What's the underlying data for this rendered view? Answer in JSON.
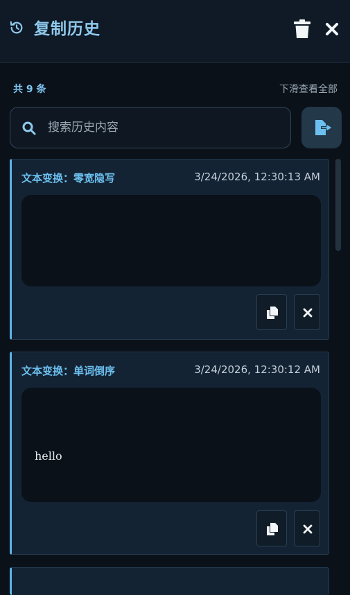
{
  "header": {
    "title": "复制历史",
    "icons": {
      "history": "history-icon",
      "trash": "trash-icon",
      "close": "close-icon"
    }
  },
  "summary": {
    "count_label": "共 9 条",
    "scroll_hint": "下滑查看全部"
  },
  "search": {
    "placeholder": "搜索历史内容",
    "value": ""
  },
  "export": {
    "icon": "export-icon"
  },
  "items": [
    {
      "type_label": "文本变换：零宽隐写",
      "timestamp": "3/24/2026, 12:30:13 AM",
      "content": ""
    },
    {
      "type_label": "文本变换：单词倒序",
      "timestamp": "3/24/2026, 12:30:12 AM",
      "content": "hello"
    }
  ],
  "colors": {
    "accent": "#6cc0ef",
    "background": "#0b1119",
    "card": "#142334"
  }
}
